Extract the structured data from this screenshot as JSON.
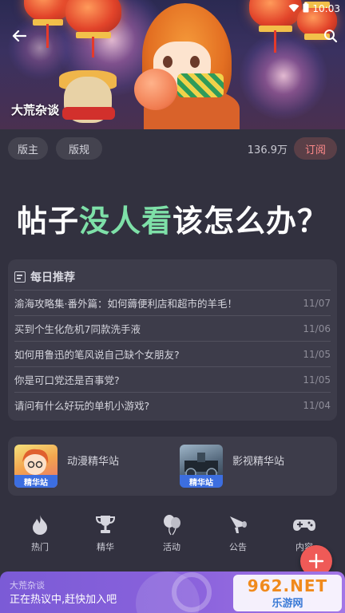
{
  "status_bar": {
    "time": "10:03"
  },
  "header": {
    "forum_name": "大荒杂谈"
  },
  "tags": {
    "moderator": "版主",
    "rules": "版规"
  },
  "meta": {
    "followers": "136.9万",
    "subscribe_label": "订阅"
  },
  "headline": {
    "before": "帖子",
    "accent": "没人看",
    "after": "该怎么办？",
    "accent_color": "#7ee0a8"
  },
  "daily": {
    "title": "每日推荐",
    "items": [
      {
        "title": "渝海攻略集·番外篇：如何薅便利店和超市的羊毛！",
        "date": "11/07"
      },
      {
        "title": "买到个生化危机7同款洗手液",
        "date": "11/06"
      },
      {
        "title": "如何用鲁迅的笔风说自己缺个女朋友?",
        "date": "11/05"
      },
      {
        "title": "你是可口党还是百事党?",
        "date": "11/05"
      },
      {
        "title": "请问有什么好玩的单机小游戏?",
        "date": "11/04"
      }
    ]
  },
  "stations": [
    {
      "label": "动漫精华站",
      "badge": "精华站"
    },
    {
      "label": "影视精华站",
      "badge": "精华站"
    }
  ],
  "nav": [
    {
      "label": "热门",
      "icon": "flame-icon"
    },
    {
      "label": "精华",
      "icon": "trophy-icon"
    },
    {
      "label": "活动",
      "icon": "balloons-icon"
    },
    {
      "label": "公告",
      "icon": "megaphone-icon"
    },
    {
      "label": "内容",
      "icon": "gamepad-icon"
    }
  ],
  "chat_banner": {
    "subtitle": "大荒杂谈",
    "text": "正在热议中,赶快加入吧"
  },
  "watermark": {
    "top": "962.NET",
    "bottom": "乐游网"
  },
  "colors": {
    "background": "#32313f",
    "card": "#3d3c4a",
    "subscribe_text": "#ff8a8a",
    "fab": "#ef5a57",
    "banner": "#8a62dc"
  }
}
